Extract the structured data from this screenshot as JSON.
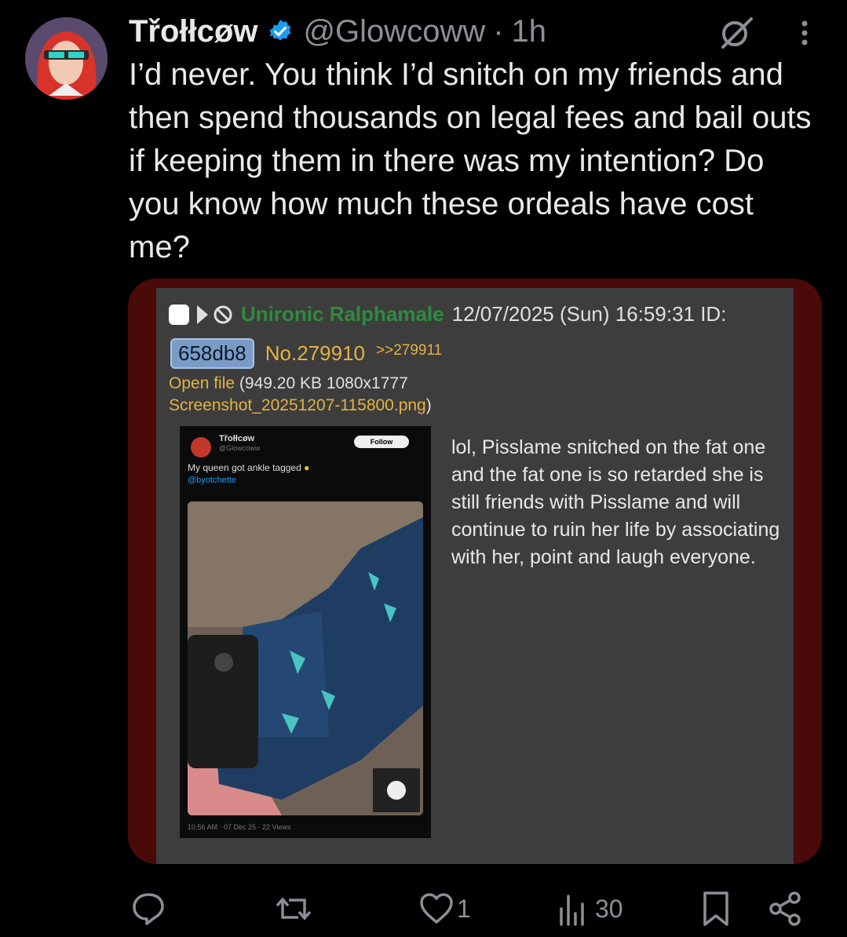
{
  "tweet": {
    "author_name": "Třołłcøw",
    "handle": "@Glowcoww",
    "separator": "·",
    "time": "1h",
    "text": "I’d never. You think I’d snitch on my friends and then spend thousands on legal fees and bail outs if keeping them in there was my intention? Do you know how much these ordeals have cost me?"
  },
  "embedded_post": {
    "poster_name": "Unironic Ralphamale",
    "datetime": "12/07/2025 (Sun) 16:59:31 ID:",
    "id_badge": "658db8",
    "post_number": "No.279910",
    "reply_link": ">>279911",
    "open_file_label": "Open file",
    "file_info": "(949.20 KB 1080x1777",
    "file_name": "Screenshot_20251207-115800.png",
    "file_close": ")",
    "body": "lol, Pisslame snitched on the fat one and the fat one is so retarded she is still friends with Pisslame and will continue to ruin her life by associating with her, point and laugh everyone."
  },
  "thumbnail": {
    "name": "Třołłcøw",
    "handle": "@Glowcoww",
    "follow_label": "Follow",
    "text": "My queen got ankle tagged",
    "tag": "@byotchette",
    "footer": "10:56 AM · 07 Dec 25 · 22 Views"
  },
  "actions": {
    "likes": "1",
    "views": "30"
  },
  "colors": {
    "background": "#000000",
    "text": "#e7e9ea",
    "secondary": "#8b9096",
    "verified": "#1d9bf0",
    "poster_green": "#2e8b3e",
    "link_yellow": "#e3b341"
  }
}
